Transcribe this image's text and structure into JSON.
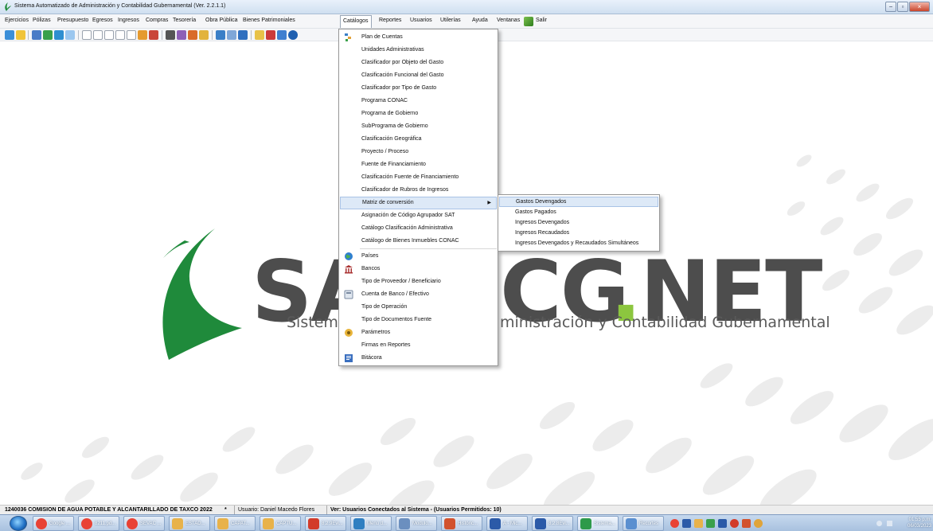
{
  "window": {
    "title": "Sistema Automatizado de Administración y Contabilidad Gubernamental  (Ver. 2.2.1.1)",
    "controls": [
      "−",
      "▫",
      "×"
    ]
  },
  "menubar": {
    "items": [
      "Ejercicios",
      "Pólizas",
      "Presupuesto",
      "Egresos",
      "Ingresos",
      "Compras",
      "Tesorería",
      "Obra Pública",
      "Bienes Patrimoniales",
      "Catálogos",
      "Reportes",
      "Usuarios",
      "Utilerías",
      "Ayuda",
      "Ventanas",
      "Salir"
    ],
    "active": "Catálogos"
  },
  "catalogos_menu": {
    "items": [
      {
        "label": "Plan de Cuentas",
        "icon": "accounts-icon"
      },
      {
        "label": "Unidades Administrativas"
      },
      {
        "label": "Clasificador por Objeto del Gasto"
      },
      {
        "label": "Clasificación Funcional del Gasto"
      },
      {
        "label": "Clasificador por Tipo de Gasto"
      },
      {
        "label": "Programa CONAC"
      },
      {
        "label": "Programa de Gobierno"
      },
      {
        "label": "SubPrograma de Gobierno"
      },
      {
        "label": "Clasificación Geográfica"
      },
      {
        "label": "Proyecto / Proceso"
      },
      {
        "label": "Fuente de Financiamiento"
      },
      {
        "label": "Clasificación Fuente de Financiamiento"
      },
      {
        "label": "Clasificador de Rubros de Ingresos"
      },
      {
        "label": "Matriz de conversión",
        "submenu": true
      },
      {
        "label": "Asignación de Código Agrupador SAT"
      },
      {
        "label": "Catálogo Clasificación Administrativa"
      },
      {
        "label": "Catálogo de Bienes Inmuebles CONAC"
      },
      {
        "label": "Países",
        "icon": "globe-icon"
      },
      {
        "label": "Bancos",
        "icon": "bank-icon"
      },
      {
        "label": "Tipo de Proveedor / Beneficiario"
      },
      {
        "label": "Cuenta de Banco / Efectivo",
        "icon": "calculator-icon"
      },
      {
        "label": "Tipo de Operación"
      },
      {
        "label": "Tipo de Documentos Fuente"
      },
      {
        "label": "Parámetros",
        "icon": "settings-icon"
      },
      {
        "label": "Firmas en Reportes"
      },
      {
        "label": "Bitácora",
        "icon": "log-icon"
      }
    ],
    "highlighted": "Matriz de conversión"
  },
  "matriz_submenu": {
    "items": [
      "Gastos Devengados",
      "Gastos Pagados",
      "Ingresos Devengados",
      "Ingresos Recaudados",
      "Ingresos Devengados y Recaudados Simultáneos"
    ],
    "highlighted": "Gastos Devengados"
  },
  "logo": {
    "word_left": "SA",
    "word_mid": "CG",
    "word_dot": ".",
    "word_right": "NET",
    "subtitle_left": "Sistema",
    "subtitle_right": "ministración y Contabilidad Gubernamental",
    "colors": {
      "dark": "#4d4d4d",
      "green": "#1f8a3b",
      "light_green": "#8cc63f",
      "watermark": "#ececec"
    }
  },
  "statusbar": {
    "entity": "1240036 COMISION DE AGUA POTABLE Y ALCANTARILLADO DE TAXCO  2022",
    "asterisk": "*",
    "user": "Usuario: Daniel Macedo Flores",
    "connected": "Ver: Usuarios Conectados al Sistema - (Usuarios Permitidos: 10)"
  },
  "taskbar": {
    "buttons": [
      {
        "label": "Google ...",
        "icon": "chrome-icon",
        "color": "#e94235"
      },
      {
        "label": "8211.pd...",
        "icon": "chrome-icon",
        "color": "#e94235"
      },
      {
        "label": "SEVAC ...",
        "icon": "chrome-icon",
        "color": "#e94235"
      },
      {
        "label": "ESTAD...",
        "icon": "folder-icon",
        "color": "#e8b24a"
      },
      {
        "label": "CAPAT...",
        "icon": "folder-icon",
        "color": "#e8b24a"
      },
      {
        "label": "CAPTU...",
        "icon": "folder-icon",
        "color": "#e8b24a"
      },
      {
        "label": "8.2.9Evi...",
        "icon": "pdf-icon",
        "color": "#d23b2a"
      },
      {
        "label": "Menú d...",
        "icon": "app-icon",
        "color": "#2f7fc1"
      },
      {
        "label": "Modulo...",
        "icon": "app-icon",
        "color": "#6b8fbf"
      },
      {
        "label": "Históric...",
        "icon": "powerpoint-icon",
        "color": "#d2522e"
      },
      {
        "label": "A - Mic...",
        "icon": "word-icon",
        "color": "#2b5aa8"
      },
      {
        "label": "8.2.8Evi...",
        "icon": "word-icon",
        "color": "#2b5aa8"
      },
      {
        "label": "Sistema...",
        "icon": "sacg-icon",
        "color": "#2e9a4a"
      },
      {
        "label": "Recortes",
        "icon": "snipping-icon",
        "color": "#5a8fd0"
      }
    ],
    "clock_time": "01:55 p.m.",
    "clock_date": "06/03/2023"
  }
}
